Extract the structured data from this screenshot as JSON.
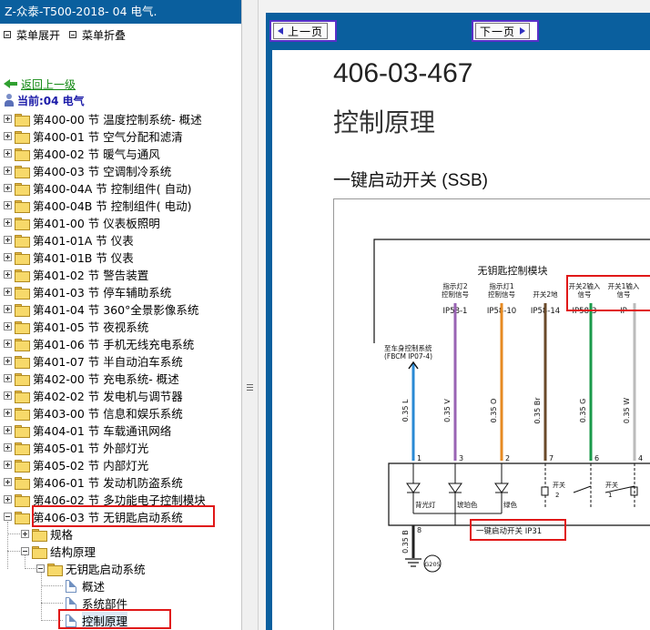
{
  "app": {
    "title": "Z-众泰-T500-2018- 04 电气."
  },
  "menu": {
    "expand_label": "菜单展开",
    "collapse_label": "菜单折叠"
  },
  "nav": {
    "back_label": "返回上一级",
    "current_label": "当前:04 电气"
  },
  "tree": {
    "sections": [
      "第400-00 节 温度控制系统- 概述",
      "第400-01 节 空气分配和滤清",
      "第400-02 节 暖气与通风",
      "第400-03 节 空调制冷系统",
      "第400-04A 节 控制组件( 自动)",
      "第400-04B 节 控制组件( 电动)",
      "第401-00 节 仪表板照明",
      "第401-01A 节 仪表",
      "第401-01B 节 仪表",
      "第401-02 节 警告装置",
      "第401-03 节 停车辅助系统",
      "第401-04 节 360°全景影像系统",
      "第401-05 节 夜视系统",
      "第401-06 节 手机无线充电系统",
      "第401-07 节 半自动泊车系统",
      "第402-00 节 充电系统- 概述",
      "第402-02 节 发电机与调节器",
      "第403-00 节 信息和娱乐系统",
      "第404-01 节 车载通讯网络",
      "第405-01 节 外部灯光",
      "第405-02 节 内部灯光",
      "第406-01 节 发动机防盗系统",
      "第406-02 节 多功能电子控制模块"
    ],
    "open_section": "第406-03 节 无钥匙启动系统",
    "children": {
      "spec": "规格",
      "structure": "结构原理",
      "system": "无钥匙启动系统",
      "docs": [
        "概述",
        "系统部件",
        "控制原理"
      ]
    }
  },
  "viewer": {
    "prev_label": "上一页",
    "next_label": "下一页",
    "doc_code": "406-03-467",
    "heading": "控制原理",
    "subheading": "一键启动开关 (SSB)"
  },
  "diagram": {
    "module_title": "无钥匙控制模块",
    "signal_labels": [
      [
        "指示灯2",
        "控制信号"
      ],
      [
        "指示灯1",
        "控制信号"
      ],
      [
        "开关2地"
      ],
      [
        "开关2输入",
        "信号"
      ],
      [
        "开关1输入",
        "信号"
      ]
    ],
    "pin_labels": [
      "IP58-1",
      "IP58-10",
      "IP58-14",
      "IP58-3",
      "IP"
    ],
    "ext_label": [
      "至车身控制系统",
      "(FBCM  IP07-4)"
    ],
    "wire_labels": [
      "0.35 L",
      "0.35 V",
      "0.35 O",
      "0.35 Br",
      "0.35 G",
      "0.35 W",
      "0.35 B"
    ],
    "connector_pins": [
      "1",
      "3",
      "2",
      "7",
      "6",
      "4",
      "8"
    ],
    "led_labels": [
      "背光灯",
      "琥珀色",
      "绿色"
    ],
    "switch_labels": [
      "开关",
      "2",
      "开关",
      "1"
    ],
    "switch_caption": "一键启动开关 IP31",
    "ground_label": "G205",
    "colors": {
      "blue": "#2a8ad4",
      "violet": "#9a64b4",
      "orange": "#e68a22",
      "brown": "#6a4a2a",
      "green": "#1a9a4a",
      "white": "#bbbbbb",
      "black": "#222222"
    }
  }
}
